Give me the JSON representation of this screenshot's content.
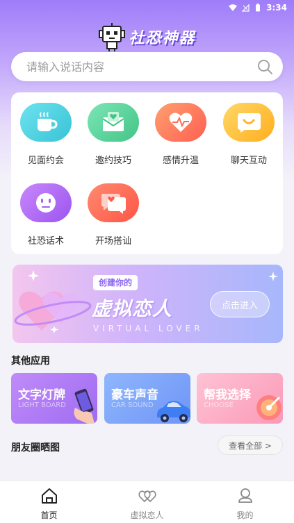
{
  "status_bar": {
    "time": "3:34"
  },
  "header": {
    "title": "社恐神器"
  },
  "search": {
    "placeholder": "请输入说话内容"
  },
  "grid": {
    "items": [
      {
        "label": "见面约会",
        "icon": "coffee-cup-icon",
        "color": "#4fd5e3"
      },
      {
        "label": "邀约技巧",
        "icon": "envelope-heart-icon",
        "color": "#5dd7a0"
      },
      {
        "label": "感情升温",
        "icon": "heartbeat-icon",
        "color": "#ff7d5d"
      },
      {
        "label": "聊天互动",
        "icon": "smile-bubble-icon",
        "color": "#ffc53d"
      },
      {
        "label": "社恐话术",
        "icon": "shy-face-icon",
        "color": "#b36cf5"
      },
      {
        "label": "开场搭讪",
        "icon": "chat-heart-icon",
        "color": "#ff6b5a"
      }
    ]
  },
  "banner": {
    "subtitle": "创建你的",
    "title": "虚拟恋人",
    "english": "VIRTUAL  LOVER",
    "button": "点击进入"
  },
  "other_apps": {
    "title": "其他应用",
    "items": [
      {
        "title": "文字灯牌",
        "subtitle": "LIGHT BOARD",
        "color": "#b27cf6"
      },
      {
        "title": "豪车声音",
        "subtitle": "CAR SOUND",
        "color": "#7ea7fb"
      },
      {
        "title": "帮我选择",
        "subtitle": "CHOOSE",
        "color": "#fca9c3"
      }
    ]
  },
  "moments": {
    "title": "朋友圈晒图",
    "view_all": "查看全部 >"
  },
  "bottom_nav": {
    "items": [
      {
        "label": "首页",
        "active": true
      },
      {
        "label": "虚拟恋人",
        "active": false
      },
      {
        "label": "我的",
        "active": false
      }
    ]
  }
}
